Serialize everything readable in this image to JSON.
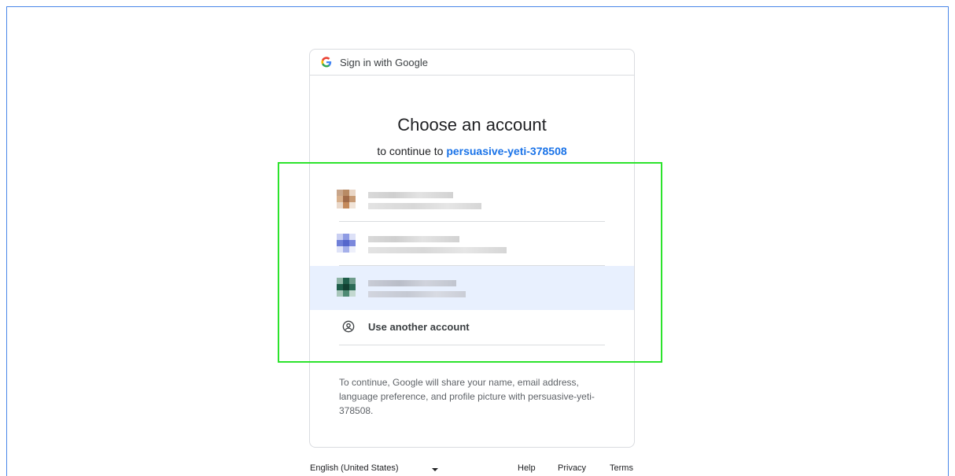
{
  "header": {
    "text": "Sign in with Google"
  },
  "main": {
    "title": "Choose an account",
    "subtitle_prefix": "to continue to ",
    "app_name": "persuasive-yeti-378508"
  },
  "accounts": [
    {
      "avatar_colors": [
        "#b88a64",
        "#d8b08c",
        "#a06a48",
        "#c79a74"
      ],
      "selected": false
    },
    {
      "avatar_colors": [
        "#6f7fd8",
        "#8e9be3",
        "#5566cc",
        "#a5b0ea"
      ],
      "selected": false
    },
    {
      "avatar_colors": [
        "#1f5d4a",
        "#4f8a74",
        "#123f31",
        "#8fb5a6"
      ],
      "selected": true
    }
  ],
  "use_another": {
    "label": "Use another account"
  },
  "disclaimer": "To continue, Google will share your name, email address, language preference, and profile picture with persuasive-yeti-378508.",
  "footer": {
    "language": "English (United States)",
    "help": "Help",
    "privacy": "Privacy",
    "terms": "Terms"
  },
  "colors": {
    "accent": "#1a73e8",
    "highlight_outline": "#2ce32c",
    "selected_row": "#e8f0fe"
  }
}
